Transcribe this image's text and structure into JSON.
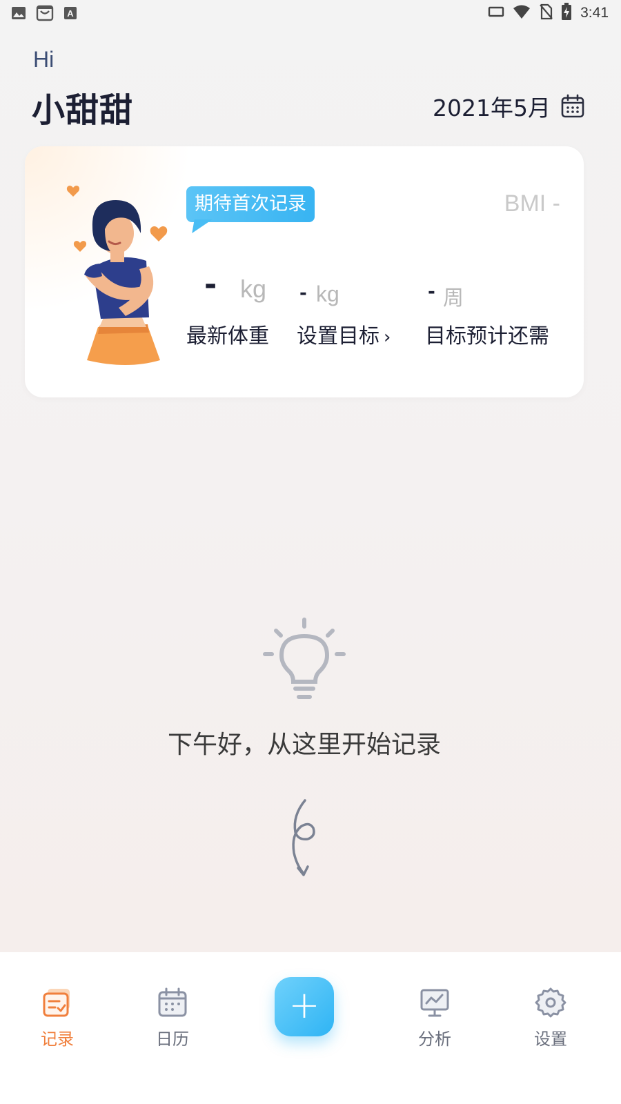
{
  "status_bar": {
    "time": "3:41"
  },
  "header": {
    "greeting": "Hi",
    "username": "小甜甜",
    "month": "2021年5月"
  },
  "card": {
    "badge": "期待首次记录",
    "bmi": "BMI -",
    "latest_weight": {
      "value": "-",
      "unit": "kg",
      "label": "最新体重"
    },
    "goal": {
      "value": "-",
      "unit": "kg",
      "label": "设置目标"
    },
    "weeks_remaining": {
      "value": "-",
      "unit": "周",
      "label": "目标预计还需"
    }
  },
  "empty_state": {
    "message": "下午好，从这里开始记录"
  },
  "bottom_nav": {
    "items": [
      {
        "label": "记录",
        "icon": "records-icon",
        "active": true
      },
      {
        "label": "日历",
        "icon": "calendar-icon",
        "active": false
      },
      {
        "label": "分析",
        "icon": "analysis-icon",
        "active": false
      },
      {
        "label": "设置",
        "icon": "settings-icon",
        "active": false
      }
    ],
    "add_button": "+"
  },
  "colors": {
    "accent_orange": "#f07f3c",
    "accent_blue": "#38b4f2",
    "text_dark": "#1c1f33",
    "muted": "#b8b8b8"
  }
}
